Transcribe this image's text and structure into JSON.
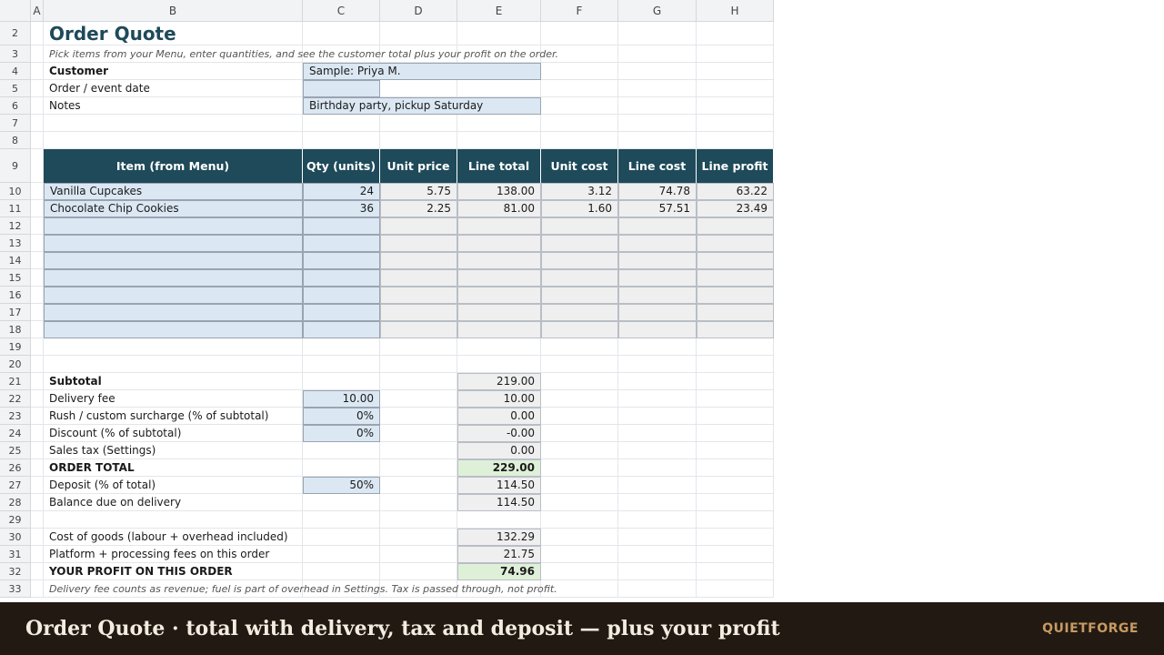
{
  "columns": [
    "A",
    "B",
    "C",
    "D",
    "E",
    "F",
    "G",
    "H"
  ],
  "rows": [
    "2",
    "3",
    "4",
    "5",
    "6",
    "7",
    "8",
    "9",
    "10",
    "11",
    "12",
    "13",
    "14",
    "15",
    "16",
    "17",
    "18",
    "19",
    "20",
    "21",
    "22",
    "23",
    "24",
    "25",
    "26",
    "27",
    "28",
    "29",
    "30",
    "31",
    "32",
    "33"
  ],
  "title": "Order Quote",
  "subtitle": "Pick items from your Menu, enter quantities, and see the customer total plus your profit on the order.",
  "fields": {
    "customer_label": "Customer",
    "customer_value": "Sample: Priya M.",
    "date_label": "Order / event date",
    "date_value": "",
    "notes_label": "Notes",
    "notes_value": "Birthday party, pickup Saturday"
  },
  "table": {
    "headers": [
      "Item (from Menu)",
      "Qty (units)",
      "Unit price",
      "Line total",
      "Unit cost",
      "Line cost",
      "Line profit"
    ],
    "rows": [
      [
        "Vanilla Cupcakes",
        "24",
        "5.75",
        "138.00",
        "3.12",
        "74.78",
        "63.22"
      ],
      [
        "Chocolate Chip Cookies",
        "36",
        "2.25",
        "81.00",
        "1.60",
        "57.51",
        "23.49"
      ],
      [
        "",
        "",
        "",
        "",
        "",
        "",
        ""
      ],
      [
        "",
        "",
        "",
        "",
        "",
        "",
        ""
      ],
      [
        "",
        "",
        "",
        "",
        "",
        "",
        ""
      ],
      [
        "",
        "",
        "",
        "",
        "",
        "",
        ""
      ],
      [
        "",
        "",
        "",
        "",
        "",
        "",
        ""
      ],
      [
        "",
        "",
        "",
        "",
        "",
        "",
        ""
      ],
      [
        "",
        "",
        "",
        "",
        "",
        "",
        ""
      ]
    ]
  },
  "summary": {
    "subtotal_label": "Subtotal",
    "subtotal": "219.00",
    "delivery_label": "Delivery fee",
    "delivery_input": "10.00",
    "delivery": "10.00",
    "rush_label": "Rush / custom surcharge (% of subtotal)",
    "rush_input": "0%",
    "rush": "0.00",
    "discount_label": "Discount (% of subtotal)",
    "discount_input": "0%",
    "discount": "-0.00",
    "tax_label": "Sales tax (Settings)",
    "tax": "0.00",
    "total_label": "ORDER TOTAL",
    "total": "229.00",
    "deposit_label": "Deposit (% of total)",
    "deposit_input": "50%",
    "deposit": "114.50",
    "balance_label": "Balance due on delivery",
    "balance": "114.50",
    "cogs_label": "Cost of goods (labour + overhead included)",
    "cogs": "132.29",
    "fees_label": "Platform + processing fees on this order",
    "fees": "21.75",
    "profit_label": "YOUR PROFIT ON THIS ORDER",
    "profit": "74.96",
    "footnote": "Delivery fee counts as revenue; fuel is part of overhead in Settings. Tax is passed through, not profit."
  },
  "banner": {
    "title": "Order Quote · total with delivery, tax and deposit — plus your profit",
    "brand": "QUIETFORGE"
  }
}
